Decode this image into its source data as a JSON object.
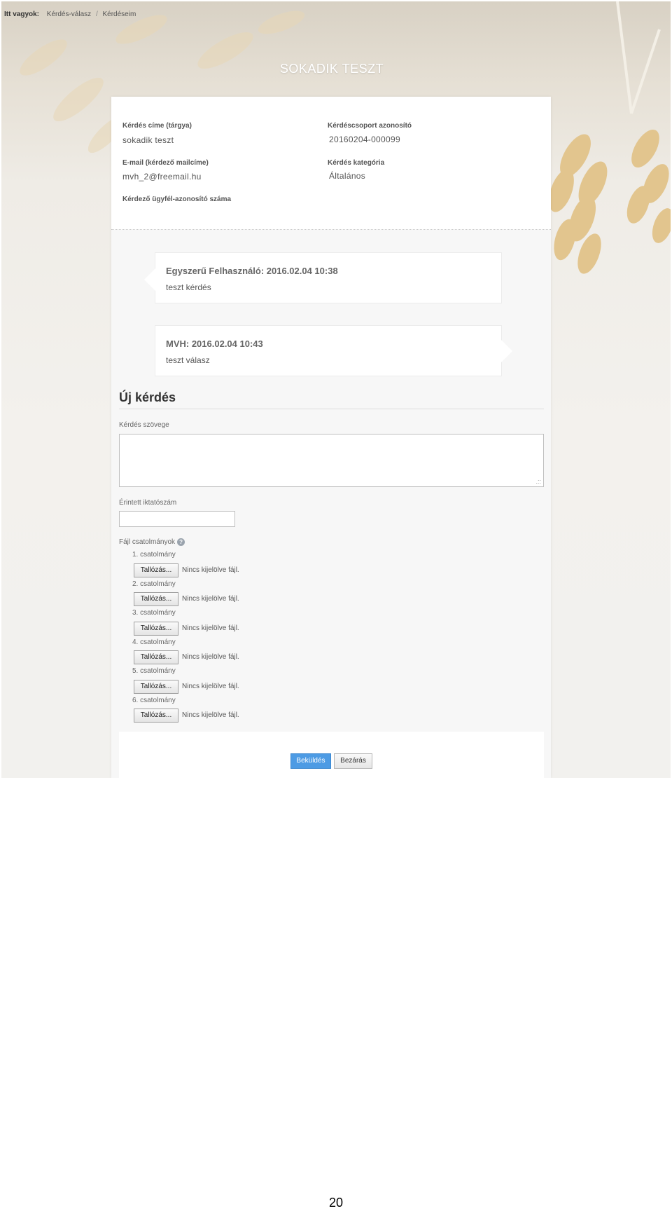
{
  "breadcrumb": {
    "label": "Itt vagyok:",
    "items": [
      "Kérdés-válasz",
      "Kérdéseim"
    ]
  },
  "title": "SOKADIK TESZT",
  "info": {
    "subject_label": "Kérdés címe (tárgya)",
    "subject_value": "sokadik teszt",
    "group_id_label": "Kérdéscsoport azonosító",
    "group_id_value": "20160204-000099",
    "email_label": "E-mail (kérdező mailcíme)",
    "email_value": "mvh_2@freemail.hu",
    "category_label": "Kérdés kategória",
    "category_value": "Általános",
    "client_id_label": "Kérdező ügyfél-azonosító száma"
  },
  "messages": [
    {
      "header": "Egyszerű Felhasználó: 2016.02.04 10:38",
      "text": "teszt kérdés"
    },
    {
      "header": "MVH: 2016.02.04 10:43",
      "text": "teszt válasz"
    }
  ],
  "new_question": {
    "heading": "Új kérdés",
    "text_label": "Kérdés szövege",
    "ref_label": "Érintett iktatószám",
    "attachments_label": "Fájl csatolmányok",
    "attachments": [
      {
        "label": "1. csatolmány",
        "button": "Tallózás...",
        "status": "Nincs kijelölve fájl."
      },
      {
        "label": "2. csatolmány",
        "button": "Tallózás...",
        "status": "Nincs kijelölve fájl."
      },
      {
        "label": "3. csatolmány",
        "button": "Tallózás...",
        "status": "Nincs kijelölve fájl."
      },
      {
        "label": "4. csatolmány",
        "button": "Tallózás...",
        "status": "Nincs kijelölve fájl."
      },
      {
        "label": "5. csatolmány",
        "button": "Tallózás...",
        "status": "Nincs kijelölve fájl."
      },
      {
        "label": "6. csatolmány",
        "button": "Tallózás...",
        "status": "Nincs kijelölve fájl."
      }
    ]
  },
  "buttons": {
    "send": "Beküldés",
    "close": "Bezárás"
  },
  "page_number": "20",
  "colors": {
    "accent": "#4d9be4",
    "card": "#f7f7f7",
    "background": "#efece6"
  },
  "icons": {
    "help": "help-icon"
  }
}
